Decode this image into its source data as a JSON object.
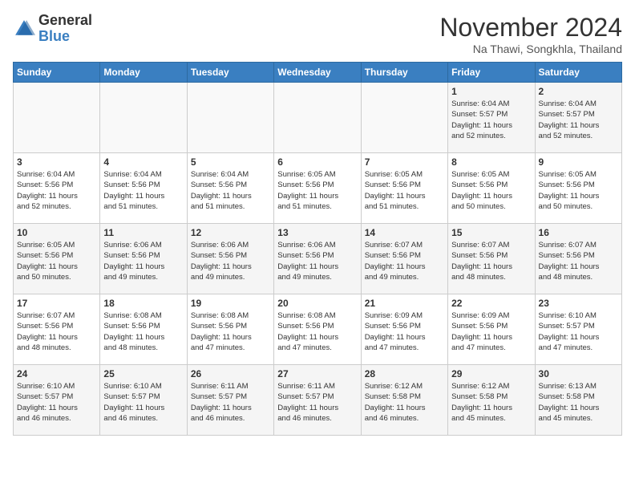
{
  "header": {
    "logo_general": "General",
    "logo_blue": "Blue",
    "month": "November 2024",
    "location": "Na Thawi, Songkhla, Thailand"
  },
  "weekdays": [
    "Sunday",
    "Monday",
    "Tuesday",
    "Wednesday",
    "Thursday",
    "Friday",
    "Saturday"
  ],
  "weeks": [
    [
      {
        "day": "",
        "info": ""
      },
      {
        "day": "",
        "info": ""
      },
      {
        "day": "",
        "info": ""
      },
      {
        "day": "",
        "info": ""
      },
      {
        "day": "",
        "info": ""
      },
      {
        "day": "1",
        "info": "Sunrise: 6:04 AM\nSunset: 5:57 PM\nDaylight: 11 hours\nand 52 minutes."
      },
      {
        "day": "2",
        "info": "Sunrise: 6:04 AM\nSunset: 5:57 PM\nDaylight: 11 hours\nand 52 minutes."
      }
    ],
    [
      {
        "day": "3",
        "info": "Sunrise: 6:04 AM\nSunset: 5:56 PM\nDaylight: 11 hours\nand 52 minutes."
      },
      {
        "day": "4",
        "info": "Sunrise: 6:04 AM\nSunset: 5:56 PM\nDaylight: 11 hours\nand 51 minutes."
      },
      {
        "day": "5",
        "info": "Sunrise: 6:04 AM\nSunset: 5:56 PM\nDaylight: 11 hours\nand 51 minutes."
      },
      {
        "day": "6",
        "info": "Sunrise: 6:05 AM\nSunset: 5:56 PM\nDaylight: 11 hours\nand 51 minutes."
      },
      {
        "day": "7",
        "info": "Sunrise: 6:05 AM\nSunset: 5:56 PM\nDaylight: 11 hours\nand 51 minutes."
      },
      {
        "day": "8",
        "info": "Sunrise: 6:05 AM\nSunset: 5:56 PM\nDaylight: 11 hours\nand 50 minutes."
      },
      {
        "day": "9",
        "info": "Sunrise: 6:05 AM\nSunset: 5:56 PM\nDaylight: 11 hours\nand 50 minutes."
      }
    ],
    [
      {
        "day": "10",
        "info": "Sunrise: 6:05 AM\nSunset: 5:56 PM\nDaylight: 11 hours\nand 50 minutes."
      },
      {
        "day": "11",
        "info": "Sunrise: 6:06 AM\nSunset: 5:56 PM\nDaylight: 11 hours\nand 49 minutes."
      },
      {
        "day": "12",
        "info": "Sunrise: 6:06 AM\nSunset: 5:56 PM\nDaylight: 11 hours\nand 49 minutes."
      },
      {
        "day": "13",
        "info": "Sunrise: 6:06 AM\nSunset: 5:56 PM\nDaylight: 11 hours\nand 49 minutes."
      },
      {
        "day": "14",
        "info": "Sunrise: 6:07 AM\nSunset: 5:56 PM\nDaylight: 11 hours\nand 49 minutes."
      },
      {
        "day": "15",
        "info": "Sunrise: 6:07 AM\nSunset: 5:56 PM\nDaylight: 11 hours\nand 48 minutes."
      },
      {
        "day": "16",
        "info": "Sunrise: 6:07 AM\nSunset: 5:56 PM\nDaylight: 11 hours\nand 48 minutes."
      }
    ],
    [
      {
        "day": "17",
        "info": "Sunrise: 6:07 AM\nSunset: 5:56 PM\nDaylight: 11 hours\nand 48 minutes."
      },
      {
        "day": "18",
        "info": "Sunrise: 6:08 AM\nSunset: 5:56 PM\nDaylight: 11 hours\nand 48 minutes."
      },
      {
        "day": "19",
        "info": "Sunrise: 6:08 AM\nSunset: 5:56 PM\nDaylight: 11 hours\nand 47 minutes."
      },
      {
        "day": "20",
        "info": "Sunrise: 6:08 AM\nSunset: 5:56 PM\nDaylight: 11 hours\nand 47 minutes."
      },
      {
        "day": "21",
        "info": "Sunrise: 6:09 AM\nSunset: 5:56 PM\nDaylight: 11 hours\nand 47 minutes."
      },
      {
        "day": "22",
        "info": "Sunrise: 6:09 AM\nSunset: 5:56 PM\nDaylight: 11 hours\nand 47 minutes."
      },
      {
        "day": "23",
        "info": "Sunrise: 6:10 AM\nSunset: 5:57 PM\nDaylight: 11 hours\nand 47 minutes."
      }
    ],
    [
      {
        "day": "24",
        "info": "Sunrise: 6:10 AM\nSunset: 5:57 PM\nDaylight: 11 hours\nand 46 minutes."
      },
      {
        "day": "25",
        "info": "Sunrise: 6:10 AM\nSunset: 5:57 PM\nDaylight: 11 hours\nand 46 minutes."
      },
      {
        "day": "26",
        "info": "Sunrise: 6:11 AM\nSunset: 5:57 PM\nDaylight: 11 hours\nand 46 minutes."
      },
      {
        "day": "27",
        "info": "Sunrise: 6:11 AM\nSunset: 5:57 PM\nDaylight: 11 hours\nand 46 minutes."
      },
      {
        "day": "28",
        "info": "Sunrise: 6:12 AM\nSunset: 5:58 PM\nDaylight: 11 hours\nand 46 minutes."
      },
      {
        "day": "29",
        "info": "Sunrise: 6:12 AM\nSunset: 5:58 PM\nDaylight: 11 hours\nand 45 minutes."
      },
      {
        "day": "30",
        "info": "Sunrise: 6:13 AM\nSunset: 5:58 PM\nDaylight: 11 hours\nand 45 minutes."
      }
    ]
  ]
}
